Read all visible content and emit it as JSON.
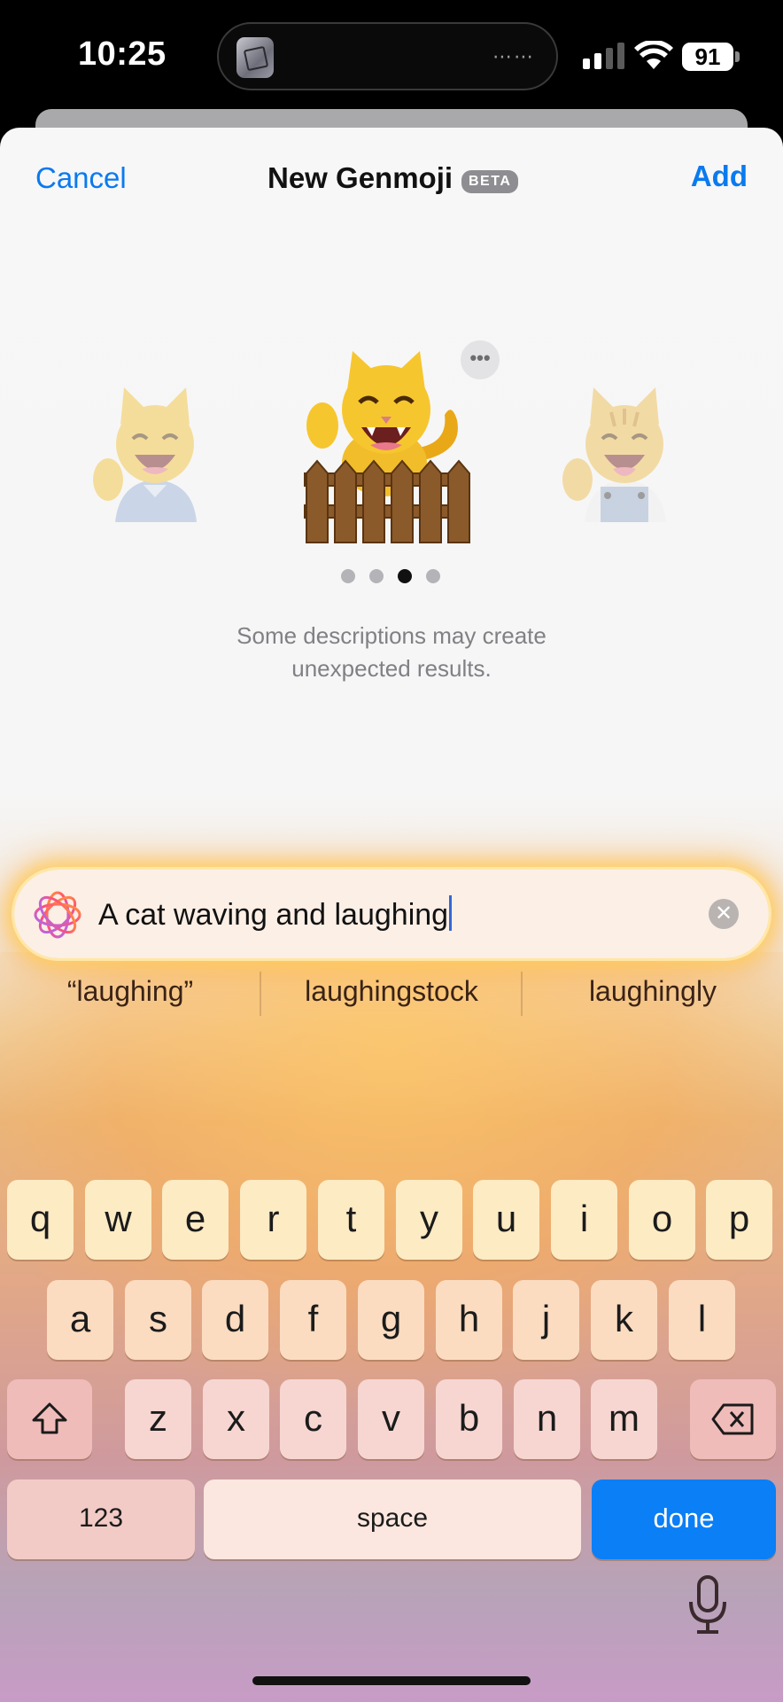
{
  "status_bar": {
    "time": "10:25",
    "battery": "91"
  },
  "header": {
    "cancel_label": "Cancel",
    "title": "New Genmoji",
    "badge": "BETA",
    "add_label": "Add"
  },
  "carousel": {
    "page_count": 4,
    "active_page_index": 2,
    "more_label": "•••"
  },
  "hint": {
    "line1": "Some descriptions may create",
    "line2": "unexpected results."
  },
  "prompt": {
    "text": "A cat waving and laughing",
    "clear_label": "✕"
  },
  "suggestions": [
    "“laughing”",
    "laughingstock",
    "laughingly"
  ],
  "keyboard": {
    "row1": [
      "q",
      "w",
      "e",
      "r",
      "t",
      "y",
      "u",
      "i",
      "o",
      "p"
    ],
    "row2": [
      "a",
      "s",
      "d",
      "f",
      "g",
      "h",
      "j",
      "k",
      "l"
    ],
    "row3": [
      "z",
      "x",
      "c",
      "v",
      "b",
      "n",
      "m"
    ],
    "numbers_label": "123",
    "space_label": "space",
    "done_label": "done"
  },
  "icons": {
    "more": "ellipsis-icon",
    "clear": "clear-icon",
    "shift": "shift-icon",
    "delete": "delete-icon",
    "mic": "microphone-icon",
    "apple_intelligence": "apple-intelligence-icon"
  },
  "colors": {
    "accent": "#0a7aef",
    "done_key": "#0a7ff6"
  }
}
